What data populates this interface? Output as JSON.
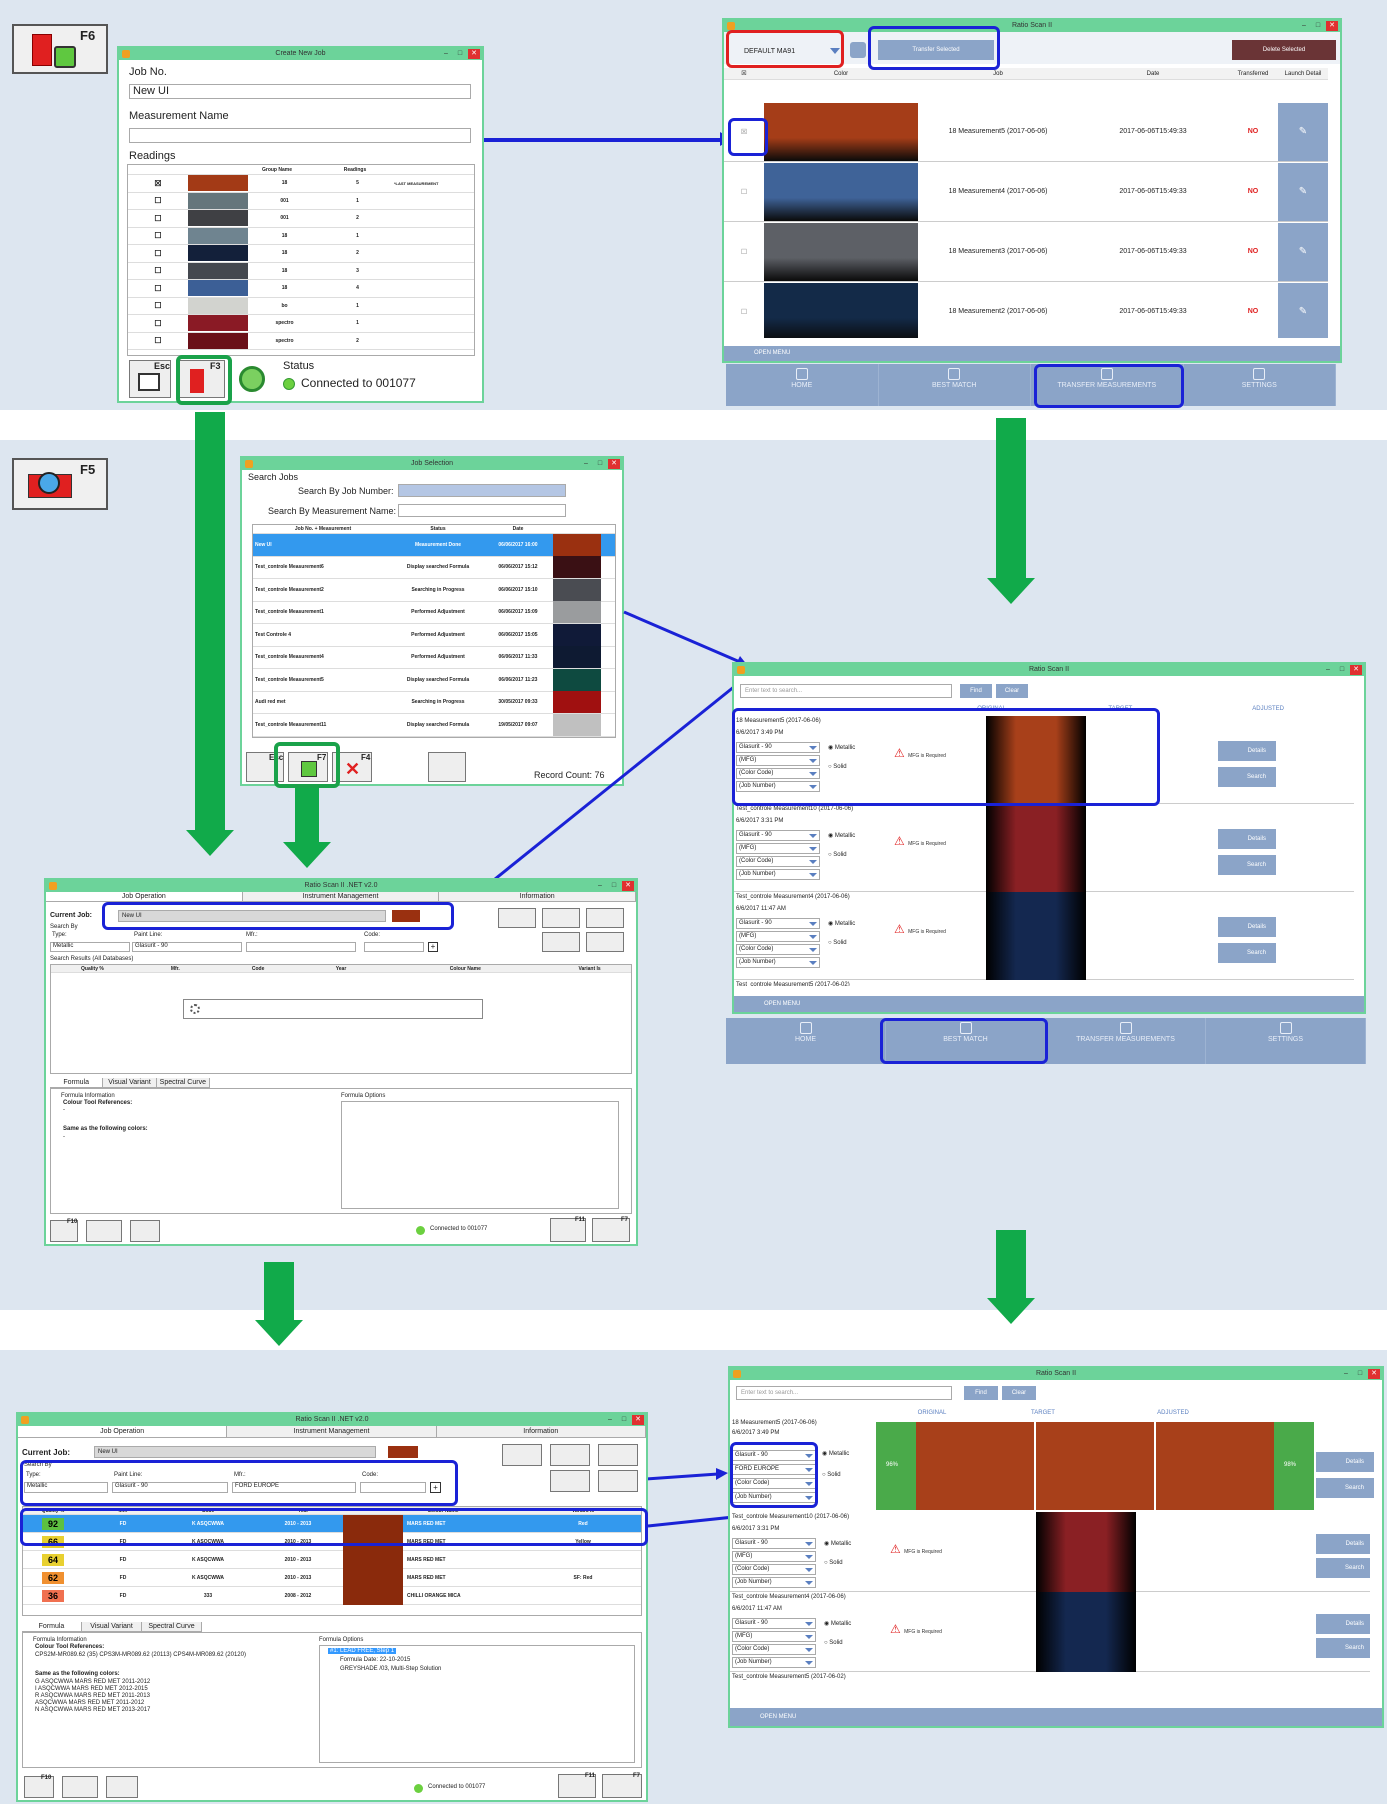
{
  "keys": {
    "f6": "F6",
    "f5": "F5",
    "esc": "Esc",
    "f3": "F3",
    "f7": "F7",
    "f4": "F4",
    "f10": "F10",
    "f11": "F11"
  },
  "create_job": {
    "title": "Create New Job",
    "job_no_label": "Job No.",
    "job_no_value": "New UI",
    "measurement_label": "Measurement Name",
    "readings_label": "Readings",
    "headers": [
      "Group Name",
      "Readings"
    ],
    "rows": [
      {
        "check": "☒",
        "color": "#a33a16",
        "group": "18",
        "readings": "5",
        "note": "*LAST MEASUREMENT"
      },
      {
        "check": "☐",
        "color": "#65767c",
        "group": "001",
        "readings": "1",
        "note": ""
      },
      {
        "check": "☐",
        "color": "#3f4044",
        "group": "001",
        "readings": "2",
        "note": ""
      },
      {
        "check": "☐",
        "color": "#6f8490",
        "group": "18",
        "readings": "1",
        "note": ""
      },
      {
        "check": "☐",
        "color": "#13203a",
        "group": "18",
        "readings": "2",
        "note": ""
      },
      {
        "check": "☐",
        "color": "#44484f",
        "group": "18",
        "readings": "3",
        "note": ""
      },
      {
        "check": "☐",
        "color": "#3c5f96",
        "group": "18",
        "readings": "4",
        "note": ""
      },
      {
        "check": "☐",
        "color": "#d2d3cf",
        "group": "bo",
        "readings": "1",
        "note": ""
      },
      {
        "check": "☐",
        "color": "#8a1a25",
        "group": "spectro",
        "readings": "1",
        "note": ""
      },
      {
        "check": "☐",
        "color": "#6a1018",
        "group": "spectro",
        "readings": "2",
        "note": ""
      }
    ],
    "status_label": "Status",
    "connected": "Connected to 001077"
  },
  "transfer": {
    "title": "Ratio Scan II",
    "profile": "DEFAULT MA91",
    "transfer_btn": "Transfer Selected",
    "delete_btn": "Delete Selected",
    "headers": [
      "☒",
      "Color",
      "Job",
      "Date",
      "Transferred",
      "Launch Detail"
    ],
    "rows": [
      {
        "check": "☒",
        "color": "#a53d18",
        "job": "18 Measurement5 (2017-06-06)",
        "date": "2017-06-06T15:49:33",
        "tr": "NO"
      },
      {
        "check": "☐",
        "color": "#3f6398",
        "job": "18 Measurement4 (2017-06-06)",
        "date": "2017-06-06T15:49:33",
        "tr": "NO"
      },
      {
        "check": "☐",
        "color": "#5d6066",
        "job": "18 Measurement3 (2017-06-06)",
        "date": "2017-06-06T15:49:33",
        "tr": "NO"
      },
      {
        "check": "☐",
        "color": "#132a48",
        "job": "18 Measurement2 (2017-06-06)",
        "date": "2017-06-06T15:49:33",
        "tr": "NO"
      }
    ],
    "open_menu": "OPEN MENU",
    "nav": [
      "HOME",
      "BEST MATCH",
      "TRANSFER MEASUREMENTS",
      "SETTINGS"
    ]
  },
  "job_sel": {
    "title": "Job Selection",
    "search_jobs": "Search Jobs",
    "by_job": "Search By Job Number:",
    "by_meas": "Search By Measurement Name:",
    "headers": [
      "Job No. + Measurement",
      "Status",
      "Date"
    ],
    "rows": [
      {
        "job": "New UI",
        "status": "Measurement Done",
        "date": "06/06/2017 16:00",
        "color": "#9a3010"
      },
      {
        "job": "Test_controle Measurement6",
        "status": "Display searched Formula",
        "date": "06/06/2017 15:12",
        "color": "#3a1014"
      },
      {
        "job": "Test_controle Measurement2",
        "status": "Searching in Progress",
        "date": "06/06/2017 15:10",
        "color": "#4a4c52"
      },
      {
        "job": "Test_controle Measurement1",
        "status": "Performed Adjustment",
        "date": "06/06/2017 15:09",
        "color": "#9a9c9e"
      },
      {
        "job": "Test Controle 4",
        "status": "Performed Adjustment",
        "date": "06/06/2017 15:05",
        "color": "#101a38"
      },
      {
        "job": "Test_controle Measurement4",
        "status": "Performed Adjustment",
        "date": "06/06/2017 11:33",
        "color": "#0e1a32"
      },
      {
        "job": "Test_controle Measurement5",
        "status": "Display searched Formula",
        "date": "06/06/2017 11:23",
        "color": "#0e4a40"
      },
      {
        "job": "Audi red met",
        "status": "Searching in Progress",
        "date": "30/05/2017 09:33",
        "color": "#a01010"
      },
      {
        "job": "Test_controle Measurement11",
        "status": "Display searched Formula",
        "date": "19/05/2017 09:07",
        "color": "#c0c0c0"
      }
    ],
    "record_count": "Record Count:  76"
  },
  "bm1": {
    "title": "Ratio Scan II",
    "search_ph": "Enter text to search...",
    "find": "Find",
    "clear": "Clear",
    "cols": [
      "ORIGINAL",
      "TARGET",
      "ADJUSTED"
    ],
    "items": [
      {
        "name": "18 Measurement5 (2017-06-06)",
        "date": "6/6/2017 3:49 PM",
        "sel": [
          "Glasurit - 90",
          "(MFG)",
          "(Color Code)",
          "(Job Number)"
        ],
        "metallic": "Metallic",
        "solid": "Solid",
        "warn": "MFG is Required",
        "color": "#a8401a"
      },
      {
        "name": "Test_controle Measurement10 (2017-06-06)",
        "date": "6/6/2017 3:31 PM",
        "sel": [
          "Glasurit - 90",
          "(MFG)",
          "(Color Code)",
          "(Job Number)"
        ],
        "metallic": "Metallic",
        "solid": "Solid",
        "warn": "MFG is Required",
        "color": "#8a2024"
      },
      {
        "name": "Test_controle Measurement4 (2017-06-06)",
        "date": "6/6/2017 11:47 AM",
        "sel": [
          "Glasurit - 90",
          "(MFG)",
          "(Color Code)",
          "(Job Number)"
        ],
        "metallic": "Metallic",
        "solid": "Solid",
        "warn": "MFG is Required",
        "color": "#142850"
      }
    ],
    "last": "Test_controle Measurement5 (2017-06-02)",
    "details": "Details",
    "search": "Search",
    "open_menu": "OPEN MENU",
    "nav": [
      "HOME",
      "BEST MATCH",
      "TRANSFER MEASUREMENTS",
      "SETTINGS"
    ]
  },
  "ratio1": {
    "title": "Ratio Scan II .NET v2.0",
    "tabs": [
      "Job Operation",
      "Instrument Management",
      "Information"
    ],
    "current_job_label": "Current Job:",
    "current_job": "New UI",
    "search_by": "Search By",
    "type_label": "Type:",
    "paint_label": "Paint Line:",
    "mfr_label": "Mfr.:",
    "code_label": "Code:",
    "type": "Metallic",
    "paint": "Glasurit - 90",
    "results_label": "Search Results (All Databases)",
    "result_headers": [
      "Quality %",
      "Mfr.",
      "Code",
      "Year",
      "Colour Name",
      "Variant Is"
    ],
    "info_tabs": [
      "Formula Information",
      "Visual Variant",
      "Spectral Curve"
    ],
    "formula_info": "Formula Information",
    "colour_refs": "Colour Tool References:",
    "dash": "-",
    "same_as": "Same as the following colors:",
    "formula_options": "Formula Options",
    "connected": "Connected to 001077"
  },
  "ratio2": {
    "title": "Ratio Scan II .NET v2.0",
    "current_job": "New UI",
    "mfr": "FORD EUROPE",
    "results": [
      {
        "q": "92",
        "qc": "#5cc040",
        "mfr": "FD",
        "code": "K ASQCWWA",
        "year": "2010 - 2013",
        "name": "MARS RED MET",
        "var": "Red"
      },
      {
        "q": "66",
        "qc": "#e8d030",
        "mfr": "FD",
        "code": "K ASQCWWA",
        "year": "2010 - 2013",
        "name": "MARS RED MET",
        "var": "Yellow"
      },
      {
        "q": "64",
        "qc": "#e8d030",
        "mfr": "FD",
        "code": "K ASQCWWA",
        "year": "2010 - 2013",
        "name": "MARS RED MET",
        "var": ""
      },
      {
        "q": "62",
        "qc": "#f09030",
        "mfr": "FD",
        "code": "K ASQCWWA",
        "year": "2010 - 2013",
        "name": "MARS RED MET",
        "var": "SF: Red"
      },
      {
        "q": "36",
        "qc": "#f07050",
        "mfr": "FD",
        "code": "333",
        "year": "2008 - 2012",
        "name": "CHILLI ORANGE MICA",
        "var": ""
      }
    ],
    "refs": "CPS2M-MR089.62 (35) CPS3M-MR089.62 (20113) CPS4M-MR089.62 (20120)",
    "same_list": [
      "G ASQCWWA MARS RED MET 2011-2012",
      "I ASQCWWA MARS RED MET 2012-2015",
      "R ASQCWWA MARS RED MET 2011-2013",
      "ASQCWWA MARS RED MET 2011-2012",
      "N ASQCWWA MARS RED MET 2013-2017"
    ],
    "opt1": "#1: LEAD FREE, Step 1",
    "opt2": "Formula Date: 22-10-2015",
    "opt3": "GREYSHADE /03, Multi-Step Solution"
  },
  "bm2": {
    "mfr": "FORD EUROPE",
    "pct_left": "96%",
    "pct_right": "98%"
  }
}
